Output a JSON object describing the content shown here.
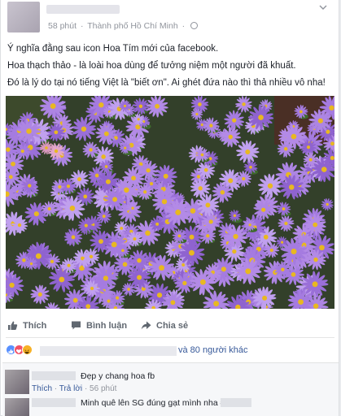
{
  "header": {
    "time": "58 phút",
    "separator": "·",
    "location": "Thành phố Hồ Chí Minh"
  },
  "post": {
    "line1": "Ý nghĩa đằng sau icon Hoa Tím mới của facebook.",
    "line2": "Hoa thạch thảo - là loài hoa dùng để tưởng niệm một người đã khuất.",
    "line3": "Đó là lý do tại nó tiếng Việt là \"biết ơn\". Ai ghét đứa nào thì thả nhiều vô nha!"
  },
  "actions": {
    "like": "Thích",
    "comment": "Bình luận",
    "share": "Chia sẻ"
  },
  "reactions": {
    "text": "và 80 người khác",
    "icons": [
      "like-icon",
      "love-icon",
      "haha-icon"
    ]
  },
  "comments": [
    {
      "text": "Đẹp y chang hoa fb",
      "like_label": "Thích",
      "reply_label": "Trả lời",
      "time": "56 phút"
    },
    {
      "text": "Minh quê lên SG đúng gạt mình nha #"
    }
  ],
  "colors": {
    "link": "#365899",
    "muted": "#90949c",
    "flower": "#a57be0"
  }
}
